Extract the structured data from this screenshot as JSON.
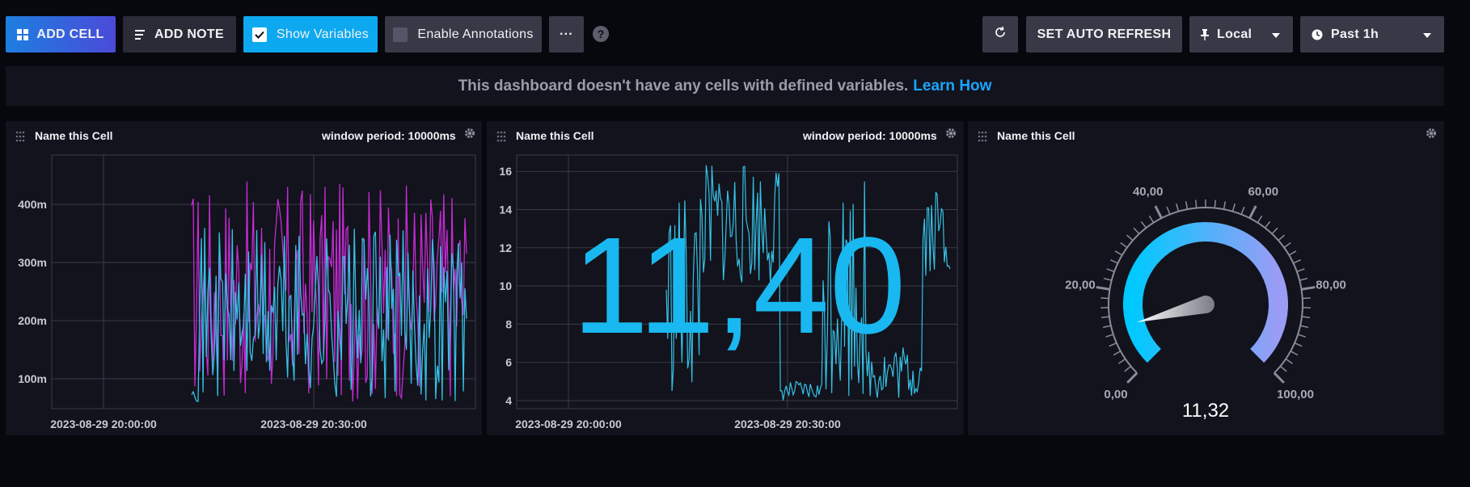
{
  "toolbar": {
    "add_cell": "ADD CELL",
    "add_note": "ADD NOTE",
    "show_variables": "Show Variables",
    "enable_annotations": "Enable Annotations",
    "more": "···",
    "help": "?",
    "set_auto_refresh": "SET AUTO REFRESH",
    "timezone": "Local",
    "time_range": "Past 1h"
  },
  "banner": {
    "message": "This dashboard doesn't have any cells with defined variables.",
    "link": "Learn How"
  },
  "cells": [
    {
      "title": "Name this Cell",
      "window_period": "window period: 10000ms",
      "chart_data": {
        "type": "line",
        "y_ticks": [
          "100m",
          "200m",
          "300m",
          "400m"
        ],
        "x_ticks": [
          "2023-08-29 20:00:00",
          "2023-08-29 20:30:00"
        ],
        "series": [
          {
            "color": "#c42bd3"
          },
          {
            "color": "#36c1e6"
          }
        ]
      }
    },
    {
      "title": "Name this Cell",
      "window_period": "window period: 10000ms",
      "single_stat": "11,40",
      "chart_data": {
        "type": "line",
        "y_ticks": [
          "4",
          "6",
          "8",
          "10",
          "12",
          "14",
          "16"
        ],
        "x_ticks": [
          "2023-08-29 20:00:00",
          "2023-08-29 20:30:00"
        ],
        "series": [
          {
            "color": "#36c1e6"
          }
        ]
      }
    },
    {
      "title": "Name this Cell",
      "gauge": {
        "value_label": "11,32",
        "value": 11.32,
        "min": 0,
        "max": 100,
        "tick_labels": [
          "0,00",
          "20,00",
          "40,00",
          "60,00",
          "80,00",
          "100,00"
        ]
      }
    }
  ]
}
